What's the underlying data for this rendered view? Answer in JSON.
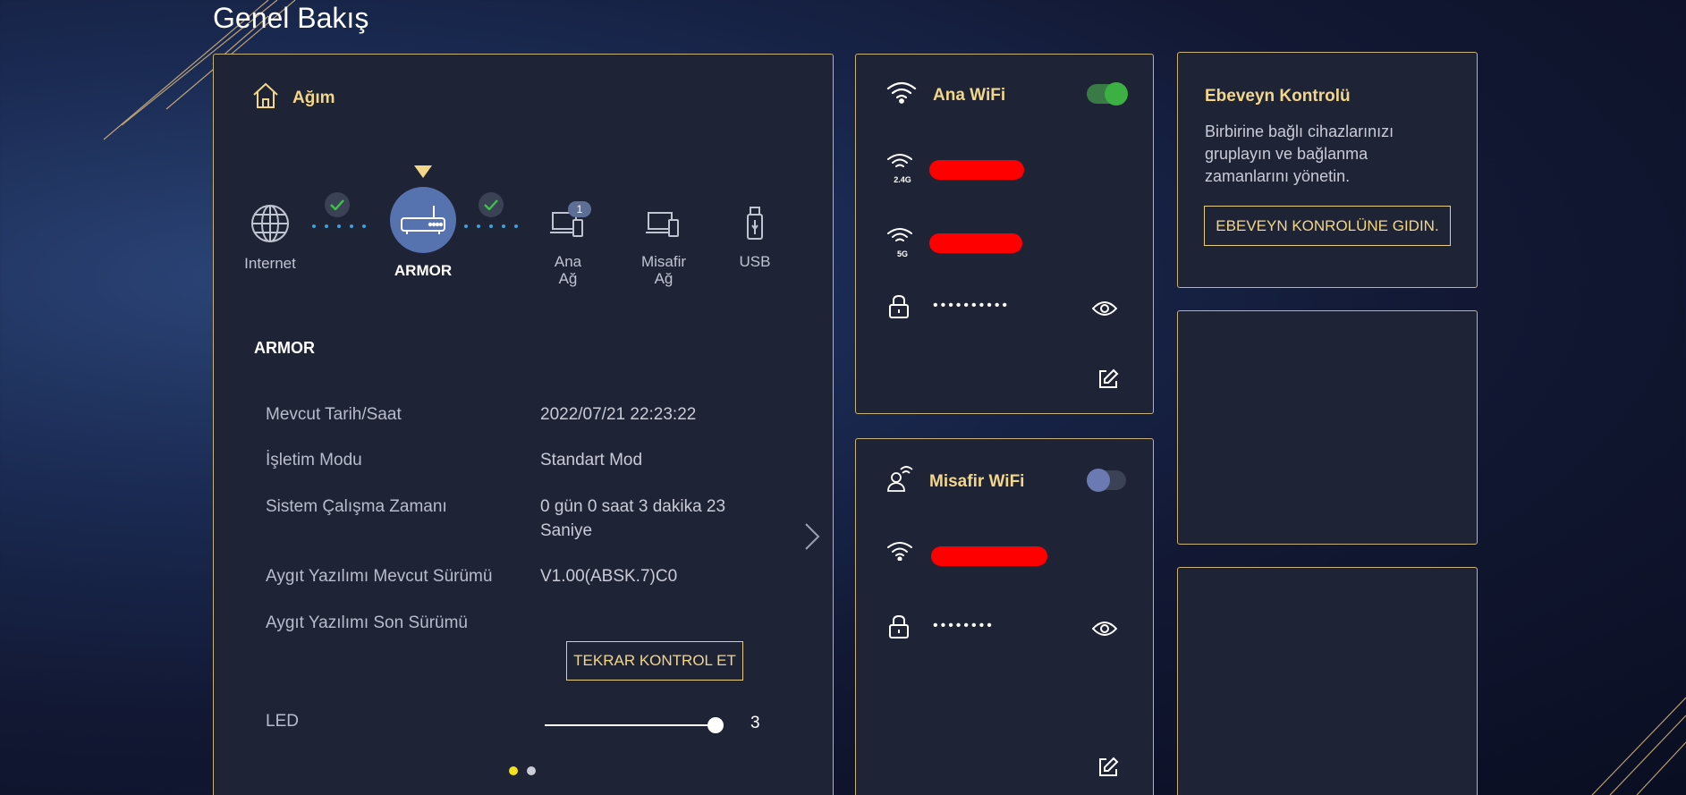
{
  "page": {
    "title": "Genel Bakış"
  },
  "network": {
    "title": "Ağım",
    "nodes": {
      "internet": "Internet",
      "router": "ARMOR",
      "main_network_line1": "Ana",
      "main_network_line2": "Ağ",
      "main_network_count": "1",
      "guest_network_line1": "Misafir",
      "guest_network_line2": "Ağ",
      "usb": "USB"
    },
    "device_title": "ARMOR",
    "info": [
      {
        "label": "Mevcut Tarih/Saat",
        "value": "2022/07/21 22:23:22"
      },
      {
        "label": "İşletim Modu",
        "value": "Standart Mod"
      },
      {
        "label": "Sistem Çalışma Zamanı",
        "value": "0 gün 0 saat 3 dakika 23 Saniye"
      },
      {
        "label": "Aygıt Yazılımı Mevcut Sürümü",
        "value": "V1.00(ABSK.7)C0"
      },
      {
        "label": "Aygıt Yazılımı Son Sürümü",
        "value": ""
      }
    ],
    "recheck_button": "TEKRAR KONTROL ET",
    "led": {
      "label": "LED",
      "value": "3",
      "level": 3,
      "max": 3
    },
    "pager": {
      "pages": 2,
      "active": 0
    }
  },
  "wifi_main": {
    "title": "Ana WiFi",
    "enabled": true,
    "band_24": "2.4G",
    "band_5": "5G",
    "password_mask": "••••••••••"
  },
  "wifi_guest": {
    "title": "Misafir WiFi",
    "enabled": false,
    "password_mask": "••••••••"
  },
  "parental": {
    "title": "Ebeveyn Kontrolü",
    "description": "Birbirine bağlı cihazlarınızı gruplayın ve bağlanma zamanlarını yönetin.",
    "button": "EBEVEYN KONROLÜNE GIDIN."
  },
  "colors": {
    "accent_gold": "#f2d68a",
    "toggle_on": "#3cb043",
    "router_blue": "#5673b0",
    "pager_active": "#f5e11c"
  }
}
